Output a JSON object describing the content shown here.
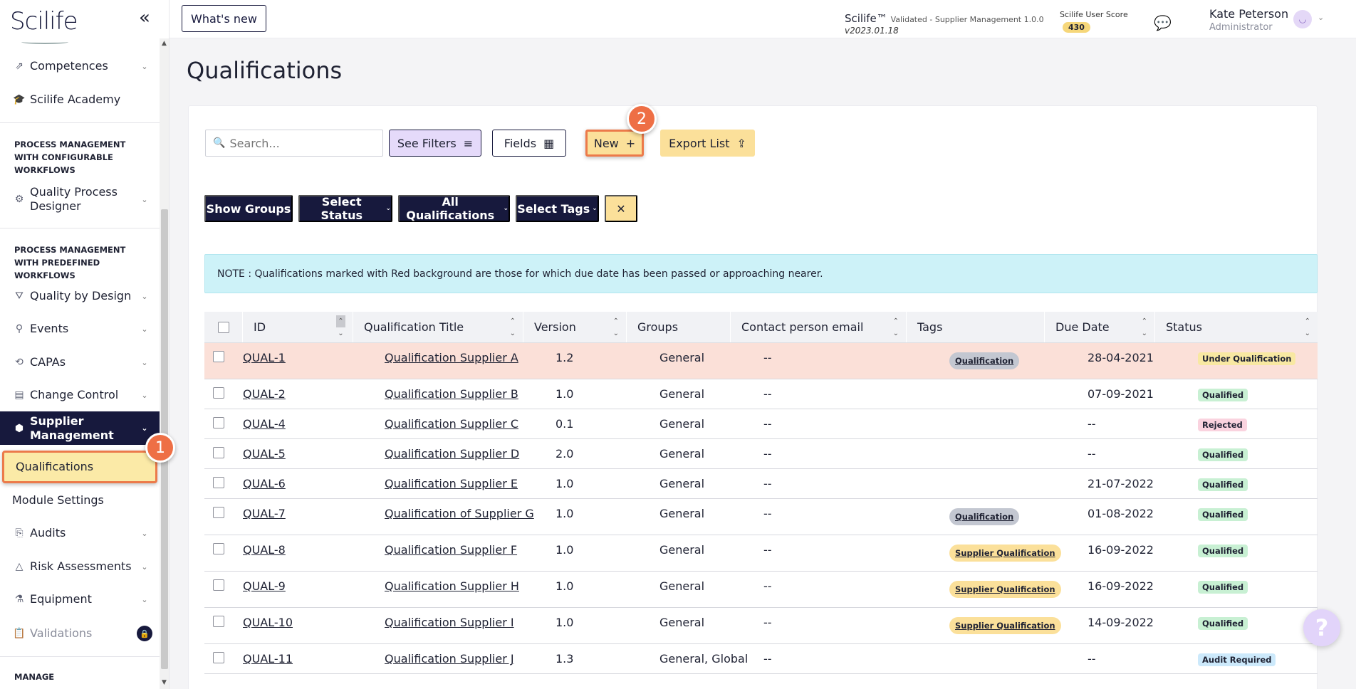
{
  "app": {
    "logo": "Scilife",
    "whats_new": "What's new",
    "version_title": "Scilife™",
    "version_detail": "Validated - Supplier Management 1.0.0",
    "version_code": "v2023.01.18",
    "score_label": "Scilife User Score",
    "score_value": "430",
    "user_name": "Kate Peterson",
    "user_role": "Administrator"
  },
  "sidebar": {
    "competences": "Competences",
    "academy": "Scilife Academy",
    "section_configurable": "PROCESS MANAGEMENT WITH CONFIGURABLE WORKFLOWS",
    "quality_process_designer": "Quality Process Designer",
    "section_predefined": "PROCESS MANAGEMENT WITH PREDEFINED WORKFLOWS",
    "quality_by_design": "Quality by Design",
    "events": "Events",
    "capas": "CAPAs",
    "change_control": "Change Control",
    "supplier_management": "Supplier Management",
    "qualifications": "Qualifications",
    "module_settings": "Module Settings",
    "audits": "Audits",
    "risk_assessments": "Risk Assessments",
    "equipment": "Equipment",
    "validations": "Validations",
    "section_manage": "MANAGE"
  },
  "steps": {
    "one": "1",
    "two": "2"
  },
  "page": {
    "title": "Qualifications",
    "search_placeholder": "Search...",
    "see_filters": "See Filters",
    "fields": "Fields",
    "new": "New",
    "export": "Export List",
    "show_groups": "Show Groups",
    "select_status": "Select Status",
    "all_qualifications": "All Qualifications",
    "select_tags": "Select Tags",
    "note": "NOTE : Qualifications marked with Red background are those for which due date has been passed or approaching nearer."
  },
  "table": {
    "headers": {
      "id": "ID",
      "title": "Qualification Title",
      "version": "Version",
      "groups": "Groups",
      "contact": "Contact person email",
      "tags": "Tags",
      "due": "Due Date",
      "status": "Status"
    },
    "rows": [
      {
        "id": "QUAL-1",
        "title": "Qualification Supplier A",
        "version": "1.2",
        "groups": "General",
        "contact": "--",
        "tag": "Qualification",
        "due": "28-04-2021",
        "status": "Under Qualification"
      },
      {
        "id": "QUAL-2",
        "title": "Qualification Supplier B",
        "version": "1.0",
        "groups": "General",
        "contact": "--",
        "tag": "",
        "due": "07-09-2021",
        "status": "Qualified"
      },
      {
        "id": "QUAL-4",
        "title": "Qualification Supplier C",
        "version": "0.1",
        "groups": "General",
        "contact": "--",
        "tag": "",
        "due": "--",
        "status": "Rejected"
      },
      {
        "id": "QUAL-5",
        "title": "Qualification Supplier D",
        "version": "2.0",
        "groups": "General",
        "contact": "--",
        "tag": "",
        "due": "--",
        "status": "Qualified"
      },
      {
        "id": "QUAL-6",
        "title": "Qualification Supplier E",
        "version": "1.0",
        "groups": "General",
        "contact": "--",
        "tag": "",
        "due": "21-07-2022",
        "status": "Qualified"
      },
      {
        "id": "QUAL-7",
        "title": "Qualification of Supplier G",
        "version": "1.0",
        "groups": "General",
        "contact": "--",
        "tag": "Qualification",
        "due": "01-08-2022",
        "status": "Qualified"
      },
      {
        "id": "QUAL-8",
        "title": "Qualification Supplier F",
        "version": "1.0",
        "groups": "General",
        "contact": "--",
        "tag": "Supplier Qualification",
        "due": "16-09-2022",
        "status": "Qualified"
      },
      {
        "id": "QUAL-9",
        "title": "Qualification Supplier H",
        "version": "1.0",
        "groups": "General",
        "contact": "--",
        "tag": "Supplier Qualification",
        "due": "16-09-2022",
        "status": "Qualified"
      },
      {
        "id": "QUAL-10",
        "title": "Qualification Supplier I",
        "version": "1.0",
        "groups": "General",
        "contact": "--",
        "tag": "Supplier Qualification",
        "due": "14-09-2022",
        "status": "Qualified"
      },
      {
        "id": "QUAL-11",
        "title": "Qualification Supplier J",
        "version": "1.3",
        "groups": "General, Global",
        "contact": "--",
        "tag": "",
        "due": "--",
        "status": "Audit Required"
      }
    ]
  },
  "colors": {
    "brand_dark": "#17193d",
    "highlight": "#ec7a4a",
    "accent_yellow": "#fbe09a",
    "overdue_row": "#fbe0d8"
  }
}
